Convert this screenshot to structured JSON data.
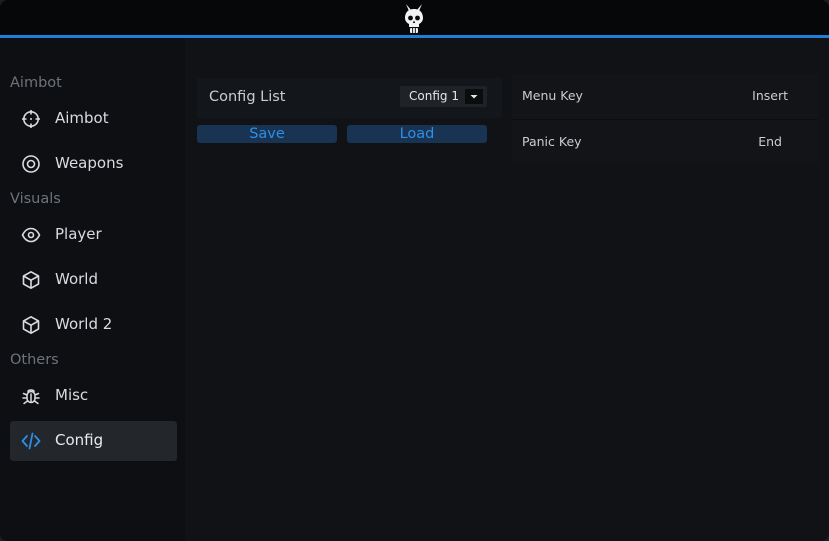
{
  "sidebar": {
    "sections": [
      {
        "title": "Aimbot",
        "items": [
          {
            "label": "Aimbot",
            "icon": "crosshair-icon"
          },
          {
            "label": "Weapons",
            "icon": "target-icon"
          }
        ]
      },
      {
        "title": "Visuals",
        "items": [
          {
            "label": "Player",
            "icon": "eye-icon"
          },
          {
            "label": "World",
            "icon": "cube-icon"
          },
          {
            "label": "World 2",
            "icon": "cube-icon"
          }
        ]
      },
      {
        "title": "Others",
        "items": [
          {
            "label": "Misc",
            "icon": "bug-icon"
          },
          {
            "label": "Config",
            "icon": "code-icon",
            "active": true
          }
        ]
      }
    ]
  },
  "config": {
    "label": "Config List",
    "selected": "Config 1",
    "save_label": "Save",
    "load_label": "Load"
  },
  "keys": {
    "menu_label": "Menu Key",
    "menu_value": "Insert",
    "panic_label": "Panic Key",
    "panic_value": "End"
  },
  "colors": {
    "accent": "#1e7fd6",
    "button_bg": "#183452",
    "button_text": "#2f8ee6"
  }
}
